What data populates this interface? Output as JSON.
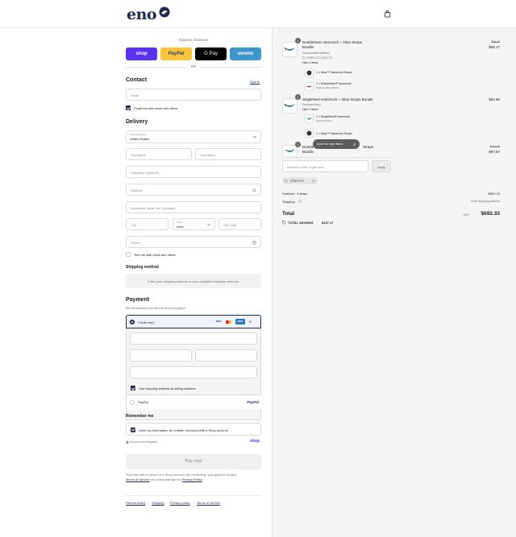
{
  "brand": {
    "logo_text": "eno",
    "colors": {
      "navy": "#1e2a4f",
      "shop_purple": "#5a31f4",
      "paypal_yellow": "#ffc439",
      "venmo_blue": "#3d95ce"
    }
  },
  "header": {
    "cart_icon": "shopping-bag-icon"
  },
  "express": {
    "title": "Express checkout",
    "shop_label": "shop",
    "paypal_label": "PayPal",
    "gpay_label": "G Pay",
    "venmo_label": "venmo",
    "or_label": "OR"
  },
  "contact": {
    "heading": "Contact",
    "sign_in": "Sign in",
    "email_placeholder": "Email",
    "news_opt_in": "Email me with news and offers"
  },
  "delivery": {
    "heading": "Delivery",
    "country_label": "Country/Region",
    "country_value": "United States",
    "first_name_placeholder": "First name",
    "last_name_placeholder": "Last name",
    "company_placeholder": "Company (optional)",
    "address_placeholder": "Address",
    "apartment_placeholder": "Apartment, suite, etc. (optional)",
    "city_placeholder": "City",
    "state_label": "State",
    "state_value": "Iowa",
    "zip_placeholder": "ZIP code",
    "phone_placeholder": "Phone",
    "text_opt_in": "Text me with news and offers"
  },
  "shipping_method": {
    "heading": "Shipping method",
    "notice": "Enter your shipping address to view available shipping methods."
  },
  "payment": {
    "heading": "Payment",
    "subtitle": "All transactions are secure and encrypted.",
    "credit_card_label": "Credit card",
    "card_brands": [
      "VISA",
      "MC",
      "AMEX",
      "+5"
    ],
    "billing_same": "Use shipping address as billing address",
    "paypal_label": "PayPal",
    "paypal_logo": "PayPal"
  },
  "remember": {
    "heading": "Remember me",
    "save_info": "Save my information for a faster checkout with a Shop account",
    "secure_note": "Secure and encrypted",
    "shop_logo": "shop"
  },
  "pay_button": "Pay now",
  "legal": {
    "line1": "Your info will be saved to a Shop account. By continuing, you agree to Shop's",
    "terms": "Terms of Service",
    "and_ack": " and acknowledge the ",
    "privacy": "Privacy Policy",
    "period": "."
  },
  "footer_links": [
    "Refund policy",
    "Shipping",
    "Privacy policy",
    "Terms of service"
  ],
  "order": {
    "items": [
      {
        "qty": "1",
        "title": "DoubleNest Hammock + Atlas Straps Bundle",
        "variant": "Seafoam/Berry/Melon",
        "discount_code": "4T2PCYJ7 (-$19.72)",
        "toggle": "Hide 2 items",
        "original_price": "$89.89",
        "price": "$69.17",
        "sub_items": [
          {
            "title": "1 × Atlas™ Hammock Straps",
            "variant": ""
          },
          {
            "title": "1 × DoubleNest® Hammock",
            "variant": "Seafoam/Berry/Melon"
          }
        ]
      },
      {
        "qty": "1",
        "title": "SingleNest Hammock + Atlas Straps Bundle",
        "variant": "Seafoam/Navy",
        "toggle": "Hide 2 items",
        "price": "$64.90",
        "sub_items": [
          {
            "title": "1 × SingleNest® Hammock",
            "variant": "Seafoam/Navy"
          },
          {
            "title": "1 × Atlas™ Hammock Straps",
            "variant": ""
          }
        ]
      },
      {
        "qty": "1",
        "title": "Double",
        "title_tail": "Straps",
        "line2": "Bundle",
        "original_price": "$114.95",
        "price": "$97.67"
      }
    ],
    "scroll_pill": "Scroll for more items",
    "discount_placeholder": "Discount code or gift card",
    "apply_label": "Apply",
    "applied_code": "4T2PCYJ7",
    "subtotal_label": "Subtotal · 5 items",
    "subtotal_value": "$692.33",
    "shipping_label": "Shipping",
    "shipping_value": "Enter shipping address",
    "total_label": "Total",
    "currency": "USD",
    "total_value": "$692.33",
    "savings_label": "TOTAL SAVINGS",
    "savings_value": "$107.17"
  }
}
